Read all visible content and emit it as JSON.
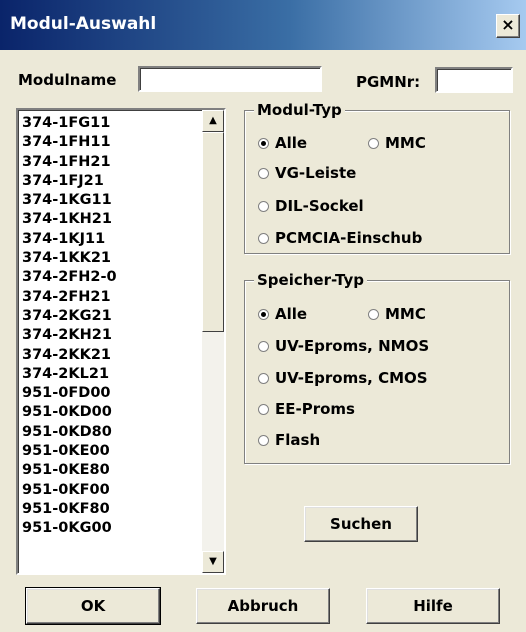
{
  "window": {
    "title": "Modul-Auswahl",
    "close_glyph": "×"
  },
  "modulname": {
    "label": "Modulname",
    "value": ""
  },
  "pgmnr": {
    "label": "PGMNr:",
    "value": ""
  },
  "module_list": [
    "374-1FG11",
    "374-1FH11",
    "374-1FH21",
    "374-1FJ21",
    "374-1KG11",
    "374-1KH21",
    "374-1KJ11",
    "374-1KK21",
    "374-2FH2-0",
    "374-2FH21",
    "374-2KG21",
    "374-2KH21",
    "374-2KK21",
    "374-2KL21",
    "951-0FD00",
    "951-0KD00",
    "951-0KD80",
    "951-0KE00",
    "951-0KE80",
    "951-0KF00",
    "951-0KF80",
    "951-0KG00"
  ],
  "modul_typ": {
    "title": "Modul-Typ",
    "options": [
      "Alle",
      "MMC",
      "VG-Leiste",
      "DIL-Sockel",
      "PCMCIA-Einschub"
    ],
    "selected": "Alle"
  },
  "speicher_typ": {
    "title": "Speicher-Typ",
    "options": [
      "Alle",
      "MMC",
      "UV-Eproms, NMOS",
      "UV-Eproms, CMOS",
      "EE-Proms",
      "Flash"
    ],
    "selected": "Alle"
  },
  "buttons": {
    "suchen": "Suchen",
    "ok": "OK",
    "abbruch": "Abbruch",
    "hilfe": "Hilfe"
  }
}
